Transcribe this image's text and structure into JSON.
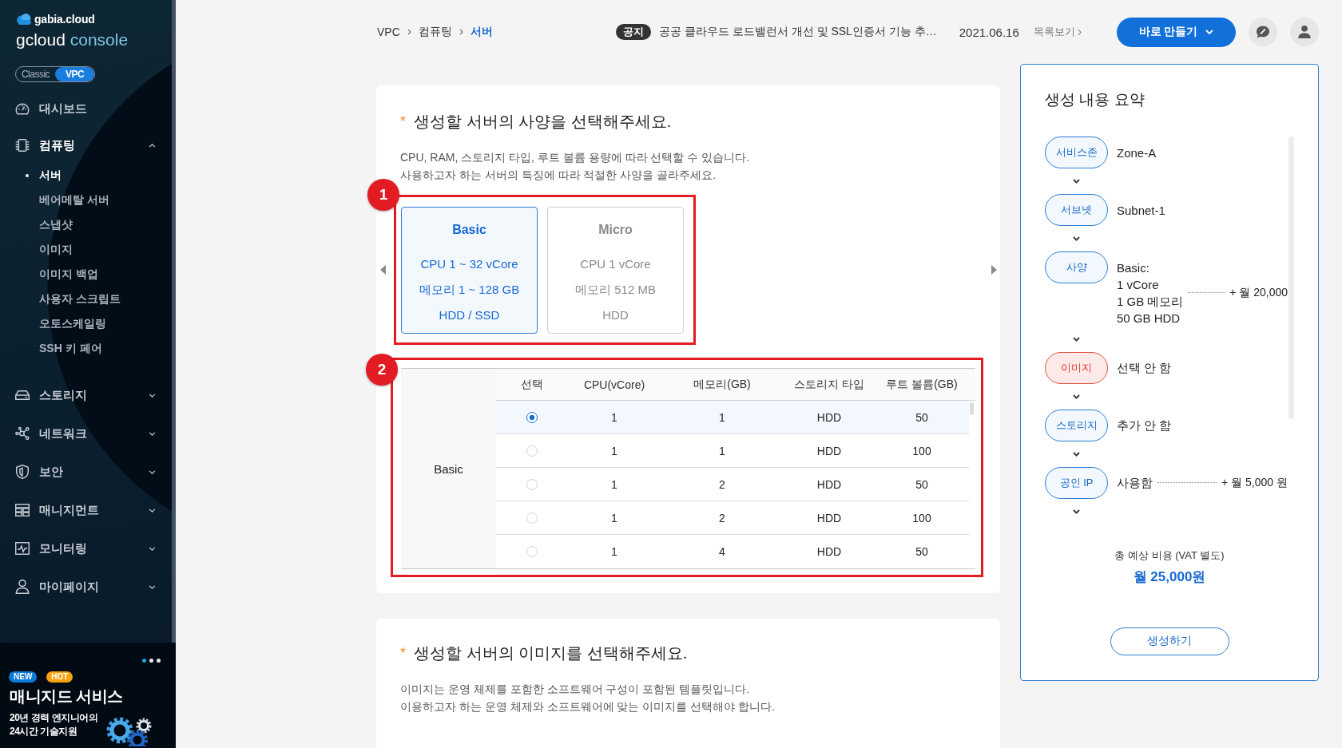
{
  "sidebar": {
    "brand": "gabia.cloud",
    "console_title": "gcloud",
    "console_accent": "console",
    "env_switch": [
      {
        "label": "Classic",
        "selected": false
      },
      {
        "label": "VPC",
        "selected": true
      }
    ],
    "dashboard": {
      "label": "대시보드"
    },
    "groups": [
      {
        "label": "컴퓨팅",
        "expanded": true,
        "children": [
          {
            "label": "서버",
            "selected": true
          },
          {
            "label": "베어메탈 서버",
            "selected": false
          },
          {
            "label": "스냅샷",
            "selected": false
          },
          {
            "label": "이미지",
            "selected": false
          },
          {
            "label": "이미지 백업",
            "selected": false
          },
          {
            "label": "사용자 스크립트",
            "selected": false
          },
          {
            "label": "오토스케일링",
            "selected": false
          },
          {
            "label": "SSH 키 페어",
            "selected": false
          }
        ]
      },
      {
        "label": "스토리지",
        "expanded": false
      },
      {
        "label": "네트워크",
        "expanded": false
      },
      {
        "label": "보안",
        "expanded": false
      },
      {
        "label": "매니지먼트",
        "expanded": false
      },
      {
        "label": "모니터링",
        "expanded": false
      },
      {
        "label": "마이페이지",
        "expanded": false
      }
    ],
    "banner": {
      "pager": [
        {
          "selected": true
        },
        {
          "selected": false
        },
        {
          "selected": false
        }
      ],
      "tags": [
        {
          "label": "NEW",
          "color": "#0a7bd8"
        },
        {
          "label": "HOT",
          "color": "#f5a30f"
        }
      ],
      "title": "매니지드 서비스",
      "lines": [
        "20년 경력 엔지니어의",
        "24시간 기술지원"
      ]
    }
  },
  "topbar": {
    "breadcrumb": [
      {
        "label": "VPC",
        "current": false
      },
      {
        "label": "컴퓨팅",
        "current": false
      },
      {
        "label": "서버",
        "current": true
      }
    ],
    "notice": {
      "tag": "공지",
      "text": "공공 클라우드 로드밸런서 개선 및 SSL인증서 기능 추…",
      "date": "2021.06.16",
      "list_link": "목록보기"
    },
    "create_button": "바로 만들기"
  },
  "spec_section": {
    "marker": "*",
    "title": "생성할 서버의 사양을 선택해주세요.",
    "description": [
      "CPU, RAM, 스토리지 타입, 루트 볼륨 용량에 따라 선택할 수 있습니다.",
      "사용하고자 하는 서버의 특징에 따라 적절한 사양을 골라주세요."
    ],
    "plans_callout": "1",
    "plans": [
      {
        "name": "Basic",
        "lines": [
          "CPU 1 ~ 32 vCore",
          "메모리 1 ~ 128 GB",
          "HDD / SSD"
        ],
        "selected": true
      },
      {
        "name": "Micro",
        "lines": [
          "CPU 1 vCore",
          "메모리 512 MB",
          "HDD"
        ],
        "selected": false
      }
    ],
    "table_callout": "2",
    "table": {
      "group_label": "Basic",
      "select_header": "선택",
      "columns": [
        "CPU(vCore)",
        "메모리(GB)",
        "스토리지 타입",
        "루트 볼륨(GB)"
      ],
      "rows": [
        {
          "selected": true,
          "cells": [
            "1",
            "1",
            "HDD",
            "50"
          ]
        },
        {
          "selected": false,
          "cells": [
            "1",
            "1",
            "HDD",
            "100"
          ]
        },
        {
          "selected": false,
          "cells": [
            "1",
            "2",
            "HDD",
            "50"
          ]
        },
        {
          "selected": false,
          "cells": [
            "1",
            "2",
            "HDD",
            "100"
          ]
        },
        {
          "selected": false,
          "cells": [
            "1",
            "4",
            "HDD",
            "50"
          ]
        }
      ]
    }
  },
  "image_section": {
    "marker": "*",
    "title": "생성할 서버의 이미지를 선택해주세요.",
    "description": [
      "이미지는 운영 체제를 포함한 소프트웨어 구성이 포함된 템플릿입니다.",
      "이용하고자 하는 운영 체제와 소프트웨어에 맞는 이미지를 선택해야 합니다."
    ]
  },
  "summary": {
    "title": "생성 내용 요약",
    "steps": [
      {
        "label": "서비스존",
        "value": [
          "Zone-A"
        ],
        "error": false
      },
      {
        "label": "서브넷",
        "value": [
          "Subnet-1"
        ],
        "error": false
      },
      {
        "label": "사양",
        "value": [
          "Basic:",
          "1 vCore",
          "1 GB 메모리",
          "50 GB HDD"
        ],
        "price": "+ 월 20,000",
        "error": false
      },
      {
        "label": "이미지",
        "value": [
          "선택 안 함"
        ],
        "error": true
      },
      {
        "label": "스토리지",
        "value": [
          "추가 안 함"
        ],
        "error": false
      },
      {
        "label": "공인 IP",
        "value": [
          "사용함"
        ],
        "price": "+ 월 5,000 원",
        "error": false
      }
    ],
    "total_label": "총 예상 비용 (VAT 별도)",
    "total": "월 25,000원",
    "submit_button": "생성하기"
  }
}
